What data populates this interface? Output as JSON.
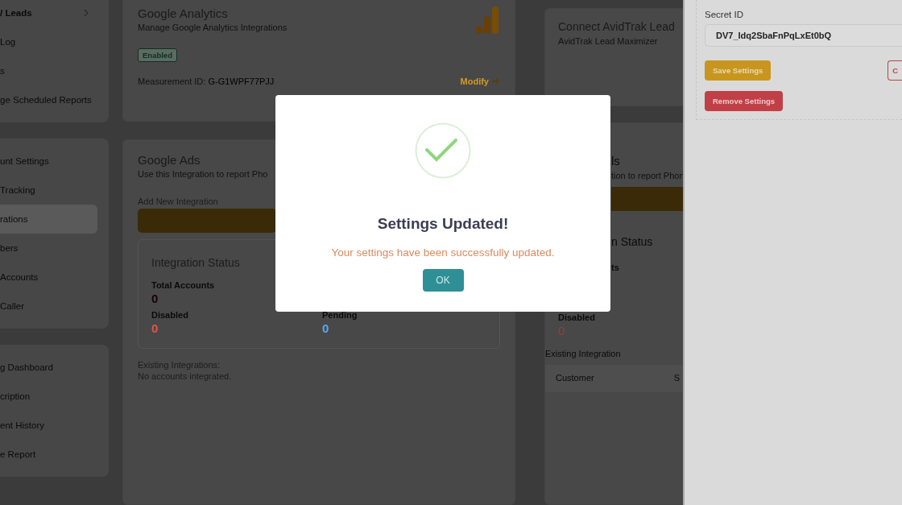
{
  "sidebar": {
    "groups": [
      {
        "items": [
          {
            "label": "/ Leads",
            "selected": false,
            "has_submenu": true
          },
          {
            "label": "Log",
            "selected": false,
            "has_submenu": false
          },
          {
            "label": "s",
            "selected": false,
            "has_submenu": false
          },
          {
            "label": "ge Scheduled Reports",
            "selected": false,
            "has_submenu": false
          }
        ]
      },
      {
        "items": [
          {
            "label": "unt Settings",
            "selected": false,
            "has_submenu": false
          },
          {
            "label": "Tracking",
            "selected": false,
            "has_submenu": false
          },
          {
            "label": "rations",
            "selected": true,
            "has_submenu": false
          },
          {
            "label": "bers",
            "selected": false,
            "has_submenu": false
          },
          {
            "label": "Accounts",
            "selected": false,
            "has_submenu": false
          },
          {
            "label": "Caller",
            "selected": false,
            "has_submenu": false
          }
        ]
      },
      {
        "items": [
          {
            "label": "g Dashboard",
            "selected": false,
            "has_submenu": false
          },
          {
            "label": "cription",
            "selected": false,
            "has_submenu": false
          },
          {
            "label": "ent History",
            "selected": false,
            "has_submenu": false
          },
          {
            "label": "e Report",
            "selected": false,
            "has_submenu": false
          }
        ]
      }
    ]
  },
  "google_analytics": {
    "title": "Google Analytics",
    "subtitle": "Manage Google Analytics Integrations",
    "status_badge": "Enabled",
    "measurement_label": "Measurement ID:",
    "measurement_id": "G-G1WPF77PJJ",
    "modify_link": "Modify"
  },
  "google_ads": {
    "title": "Google Ads",
    "subtitle": "Use this Integration to report Pho",
    "add_label": "Add New Integration",
    "status_title": "Integration Status",
    "stats": [
      {
        "label": "Total Accounts",
        "value": "0",
        "color": "#1a0000"
      },
      {
        "label": "Disabled",
        "value": "0",
        "color": "#e0554c"
      },
      {
        "label": "Pending",
        "value": "0",
        "color": "#5aa8f0"
      }
    ],
    "existing_label": "Existing Integrations:",
    "empty_text": "No accounts integrated."
  },
  "avidtrak": {
    "title": "Connect AvidTrak Lead",
    "subtitle": "AvidTrak Lead Maximizer"
  },
  "google_ads_right": {
    "title_fragment": "ls",
    "subtitle_fragment": "tion to report Phon",
    "status_title_fragment": "n Status",
    "stat_label_fragment": "ts",
    "disabled_label": "Disabled",
    "disabled_value": "0",
    "existing_label": "Existing Integration",
    "table": {
      "columns": [
        "Customer",
        "S"
      ]
    }
  },
  "drawer": {
    "secret_label": "Secret ID",
    "secret_value": "DV7_Idq2SbaFnPqLxEt0bQ",
    "buttons": [
      {
        "label": "Save Settings",
        "kind": "primary"
      },
      {
        "label": "C",
        "kind": "outline"
      },
      {
        "label": "Remove Settings",
        "kind": "danger"
      }
    ]
  },
  "modal": {
    "title": "Settings Updated!",
    "message": "Your settings have been successfully updated.",
    "button": "OK"
  }
}
